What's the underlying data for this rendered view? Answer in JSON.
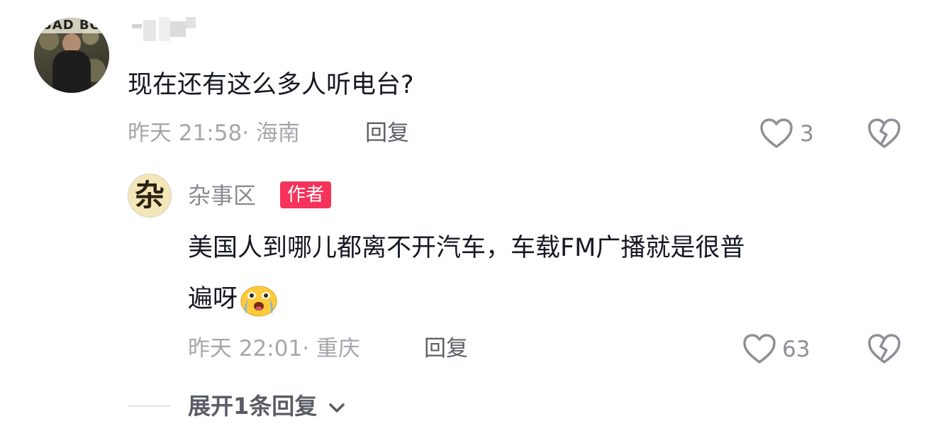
{
  "comment": {
    "avatar_text": "BAD BO",
    "text": "现在还有这么多人听电台?",
    "meta": "昨天 21:58· 海南",
    "reply_label": "回复",
    "like_count": "3"
  },
  "reply": {
    "avatar_char": "杂",
    "author": "杂事区",
    "badge": "作者",
    "text_line1": "美国人到哪儿都离不开汽车，车载FM广播就是很普",
    "text_line2": "遍呀",
    "emoji": "crying-emoji",
    "meta": "昨天 22:01· 重庆",
    "reply_label": "回复",
    "like_count": "63"
  },
  "expand_label": "展开1条回复",
  "colors": {
    "badge": "#f6335a",
    "meta": "#a6a7ab",
    "text": "#161823"
  }
}
